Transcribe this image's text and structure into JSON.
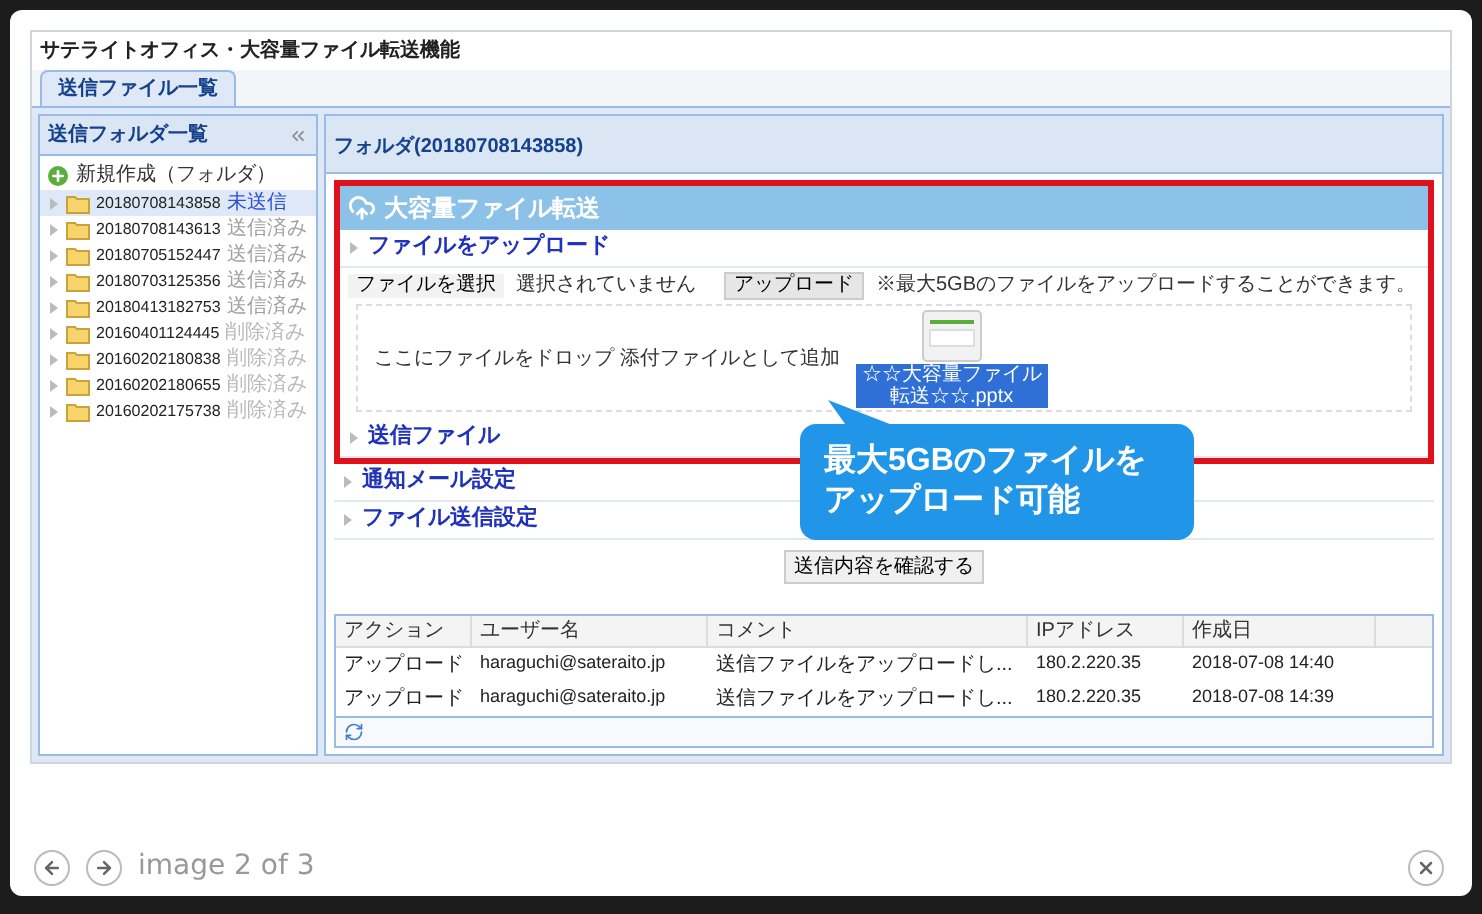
{
  "window": {
    "title": "サテライトオフィス・大容量ファイル転送機能"
  },
  "tabs": [
    {
      "label": "送信ファイル一覧",
      "selected": true
    }
  ],
  "sidebar": {
    "title": "送信フォルダ一覧",
    "new_folder": "新規作成（フォルダ）",
    "items": [
      {
        "name": "20180708143858",
        "status": "未送信",
        "color": "#2b50d8",
        "selected": true,
        "expanded": false
      },
      {
        "name": "20180708143613",
        "status": "送信済み",
        "color": "#a0a0a0",
        "selected": false,
        "expanded": false
      },
      {
        "name": "20180705152447",
        "status": "送信済み",
        "color": "#a0a0a0",
        "selected": false,
        "expanded": false
      },
      {
        "name": "20180703125356",
        "status": "送信済み",
        "color": "#a0a0a0",
        "selected": false,
        "expanded": false
      },
      {
        "name": "20180413182753",
        "status": "送信済み",
        "color": "#a0a0a0",
        "selected": false,
        "expanded": false
      },
      {
        "name": "20160401124445",
        "status": "削除済み",
        "color": "#b8b8b8",
        "selected": false,
        "expanded": false
      },
      {
        "name": "20160202180838",
        "status": "削除済み",
        "color": "#b8b8b8",
        "selected": false,
        "expanded": false
      },
      {
        "name": "20160202180655",
        "status": "削除済み",
        "color": "#b8b8b8",
        "selected": false,
        "expanded": false
      },
      {
        "name": "20160202175738",
        "status": "削除済み",
        "color": "#b8b8b8",
        "selected": false,
        "expanded": false
      }
    ]
  },
  "main": {
    "title": "フォルダ(20180708143858)",
    "banner": "大容量ファイル転送",
    "upload": {
      "heading": "ファイルをアップロード",
      "choose_button": "ファイルを選択",
      "file_status": "選択されていません",
      "upload_button": "アップロード",
      "note": "※最大5GBのファイルをアップロードすることができます。",
      "drop_text": "ここにファイルをドロップ 添付ファイルとして追加",
      "dropped_file": "☆☆大容量ファイル転送☆☆.pptx"
    },
    "sections": [
      {
        "label": "送信ファイル",
        "highlighted": true
      },
      {
        "label": "通知メール設定",
        "highlighted": false
      },
      {
        "label": "ファイル送信設定",
        "highlighted": false
      }
    ],
    "confirm_button": "送信内容を確認する"
  },
  "table": {
    "columns": [
      "アクション",
      "ユーザー名",
      "コメント",
      "IPアドレス",
      "作成日"
    ],
    "rows": [
      [
        "アップロード",
        "haraguchi@sateraito.jp",
        "送信ファイルをアップロードし...",
        "180.2.220.35",
        "2018-07-08 14:40"
      ],
      [
        "アップロード",
        "haraguchi@sateraito.jp",
        "送信ファイルをアップロードし...",
        "180.2.220.35",
        "2018-07-08 14:39"
      ]
    ]
  },
  "callout": {
    "lines": [
      "最大5GBのファイルを",
      "アップロード可能"
    ]
  },
  "lightbox": {
    "caption": "image 2 of 3"
  }
}
